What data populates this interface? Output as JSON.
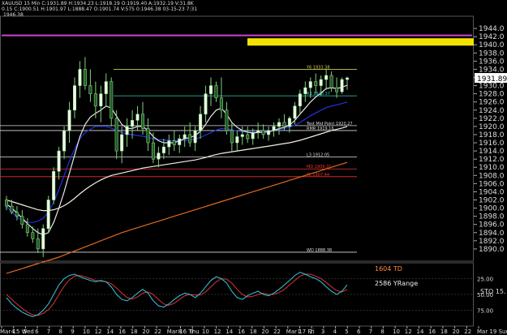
{
  "header": {
    "line1": "XAUUSD  15 Min  C:1931.89  H:1934.23  L:1918.19  O:1919.40  A:1932.19  V:31.8K",
    "line2": "1946.38",
    "line3": "0.15  C:1900.51  H:1901.97  L:1888.47  O:1901.74  V:575  0:1946.38  03-15-23  7:31"
  },
  "chart_data": {
    "type": "candlestick",
    "symbol": "XAUUSD",
    "interval": "15 Min",
    "price_axis": {
      "range": [
        1887,
        1947
      ],
      "ticks": [
        1944.0,
        1942.0,
        1940.0,
        1938.0,
        1936.0,
        1934.0,
        1932.0,
        1930.0,
        1928.0,
        1926.0,
        1924.0,
        1922.0,
        1920.0,
        1918.0,
        1916.0,
        1914.0,
        1912.0,
        1910.0,
        1908.0,
        1906.0,
        1904.0,
        1902.0,
        1900.0,
        1898.0,
        1896.0,
        1894.0,
        1892.0,
        1890.0
      ],
      "last_price": "1931.89"
    },
    "time_axis": {
      "labels": [
        "Mar 15 Wed",
        "4",
        "5",
        "6",
        "7",
        "8",
        "9",
        "10",
        "12",
        "14",
        "16",
        "18",
        "20",
        "22",
        "Mar 16 Thu",
        "8",
        "9",
        "10",
        "12",
        "14",
        "16",
        "18",
        "20",
        "22",
        "Mar 17 Fri",
        "1",
        "2",
        "3",
        "4",
        "5",
        "6",
        "7",
        "8",
        "10",
        "12",
        "14",
        "16",
        "18",
        "20",
        "22",
        "Mar 19 Sun"
      ]
    },
    "candles_ohlc": [
      [
        1902.0,
        1903.0,
        1899.5,
        1900.5
      ],
      [
        1900.5,
        1902.0,
        1898.5,
        1899.0
      ],
      [
        1899.0,
        1900.5,
        1897.0,
        1898.0
      ],
      [
        1898.0,
        1899.5,
        1895.0,
        1896.0
      ],
      [
        1896.0,
        1897.5,
        1893.0,
        1894.0
      ],
      [
        1894.0,
        1895.5,
        1891.5,
        1892.5
      ],
      [
        1892.5,
        1895.0,
        1889.0,
        1890.0
      ],
      [
        1890.0,
        1896.0,
        1888.0,
        1895.0
      ],
      [
        1895.0,
        1903.0,
        1894.0,
        1902.0
      ],
      [
        1902.0,
        1910.0,
        1901.0,
        1909.0
      ],
      [
        1909.0,
        1915.0,
        1907.0,
        1914.0
      ],
      [
        1914.0,
        1920.0,
        1912.0,
        1919.0
      ],
      [
        1919.0,
        1926.0,
        1916.0,
        1924.0
      ],
      [
        1924.0,
        1932.0,
        1922.0,
        1930.0
      ],
      [
        1930.0,
        1936.0,
        1927.0,
        1934.0
      ],
      [
        1934.0,
        1937.0,
        1929.0,
        1930.0
      ],
      [
        1930.0,
        1934.0,
        1926.0,
        1928.0
      ],
      [
        1928.0,
        1931.0,
        1922.0,
        1925.0
      ],
      [
        1925.0,
        1930.0,
        1921.0,
        1928.0
      ],
      [
        1928.0,
        1933.0,
        1925.0,
        1931.0
      ],
      [
        1931.0,
        1932.0,
        1920.0,
        1922.0
      ],
      [
        1922.0,
        1924.0,
        1912.0,
        1914.0
      ],
      [
        1914.0,
        1920.0,
        1911.0,
        1918.0
      ],
      [
        1918.0,
        1922.0,
        1915.0,
        1920.0
      ],
      [
        1920.0,
        1924.0,
        1917.0,
        1921.5
      ],
      [
        1921.5,
        1925.0,
        1919.0,
        1923.0
      ],
      [
        1923.0,
        1926.0,
        1918.0,
        1919.5
      ],
      [
        1919.5,
        1922.0,
        1914.0,
        1916.0
      ],
      [
        1916.0,
        1918.5,
        1911.0,
        1912.0
      ],
      [
        1912.0,
        1915.0,
        1910.0,
        1913.5
      ],
      [
        1913.5,
        1917.0,
        1912.0,
        1915.0
      ],
      [
        1915.0,
        1918.0,
        1913.0,
        1916.5
      ],
      [
        1916.5,
        1919.0,
        1914.0,
        1915.5
      ],
      [
        1915.5,
        1918.0,
        1913.5,
        1917.0
      ],
      [
        1917.0,
        1920.0,
        1915.0,
        1918.0
      ],
      [
        1918.0,
        1921.0,
        1915.0,
        1916.0
      ],
      [
        1916.0,
        1920.0,
        1914.0,
        1919.0
      ],
      [
        1919.0,
        1925.0,
        1917.0,
        1923.0
      ],
      [
        1923.0,
        1930.0,
        1921.0,
        1928.0
      ],
      [
        1928.0,
        1932.0,
        1925.0,
        1930.0
      ],
      [
        1930.0,
        1931.0,
        1926.0,
        1927.0
      ],
      [
        1927.0,
        1932.0,
        1922.0,
        1924.0
      ],
      [
        1924.0,
        1926.0,
        1918.0,
        1919.0
      ],
      [
        1919.0,
        1921.0,
        1914.0,
        1916.0
      ],
      [
        1916.0,
        1919.0,
        1914.0,
        1917.5
      ],
      [
        1917.5,
        1920.0,
        1915.5,
        1918.0
      ],
      [
        1918.0,
        1920.0,
        1916.0,
        1917.0
      ],
      [
        1917.0,
        1919.5,
        1915.5,
        1918.5
      ],
      [
        1918.5,
        1921.0,
        1917.0,
        1919.0
      ],
      [
        1919.0,
        1920.5,
        1917.0,
        1918.0
      ],
      [
        1918.0,
        1920.0,
        1916.5,
        1919.0
      ],
      [
        1919.0,
        1921.0,
        1917.5,
        1920.0
      ],
      [
        1920.0,
        1922.0,
        1918.0,
        1921.0
      ],
      [
        1921.0,
        1923.0,
        1919.0,
        1920.0
      ],
      [
        1920.0,
        1922.5,
        1918.5,
        1922.0
      ],
      [
        1922.0,
        1926.0,
        1920.5,
        1925.0
      ],
      [
        1925.0,
        1929.0,
        1923.0,
        1928.0
      ],
      [
        1928.0,
        1931.0,
        1926.0,
        1929.5
      ],
      [
        1929.5,
        1932.0,
        1927.0,
        1931.0
      ],
      [
        1931.0,
        1933.0,
        1928.0,
        1930.0
      ],
      [
        1930.0,
        1932.5,
        1927.5,
        1931.5
      ],
      [
        1931.5,
        1934.0,
        1929.0,
        1932.5
      ],
      [
        1932.5,
        1933.5,
        1928.5,
        1929.5
      ],
      [
        1929.5,
        1932.0,
        1927.0,
        1928.5
      ],
      [
        1928.5,
        1932.0,
        1928.0,
        1931.5
      ],
      [
        1931.5,
        1932.2,
        1929.0,
        1931.9
      ]
    ],
    "moving_averages": [
      {
        "color": "#2233dd",
        "values": [
          1900.5,
          1899.0,
          1897.8,
          1897.0,
          1896.5,
          1896.5,
          1896.8,
          1897.5,
          1899.0,
          1901.5,
          1904.5,
          1908.0,
          1911.5,
          1914.5,
          1917.0,
          1918.5,
          1919.3,
          1920.0,
          1920.0,
          1920.0,
          1919.6,
          1919.0,
          1918.5,
          1918.2,
          1918.0,
          1917.8,
          1917.6,
          1917.3,
          1917.0,
          1916.8,
          1916.7,
          1916.6,
          1916.5,
          1916.5,
          1916.6,
          1916.7,
          1916.9,
          1917.3,
          1917.9,
          1918.5,
          1919.1,
          1919.5,
          1919.5,
          1919.2,
          1918.9,
          1918.7,
          1918.6,
          1918.6,
          1918.7,
          1918.8,
          1918.9,
          1919.1,
          1919.3,
          1919.5,
          1919.8,
          1920.3,
          1921.0,
          1921.8,
          1922.6,
          1923.3,
          1924.0,
          1924.6,
          1925.0,
          1925.3,
          1925.6,
          1926.0
        ]
      },
      {
        "color": "#e6e6e6",
        "values": [
          1901.0,
          1900.0,
          1898.8,
          1897.5,
          1896.2,
          1895.0,
          1894.0,
          1893.5,
          1894.0,
          1896.5,
          1900.0,
          1904.0,
          1908.5,
          1913.0,
          1917.5,
          1920.5,
          1922.3,
          1923.2,
          1924.0,
          1925.0,
          1924.5,
          1922.5,
          1920.5,
          1919.5,
          1919.5,
          1920.0,
          1920.0,
          1919.0,
          1917.5,
          1916.5,
          1916.0,
          1916.0,
          1916.0,
          1916.5,
          1917.0,
          1917.3,
          1917.8,
          1918.8,
          1920.5,
          1922.5,
          1924.0,
          1924.5,
          1923.0,
          1921.0,
          1919.8,
          1919.0,
          1918.6,
          1918.4,
          1918.5,
          1918.6,
          1918.7,
          1919.0,
          1919.5,
          1919.8,
          1920.3,
          1921.5,
          1923.0,
          1924.5,
          1926.0,
          1927.2,
          1928.2,
          1929.3,
          1929.5,
          1929.3,
          1929.6,
          1930.1
        ]
      },
      {
        "color": "#f0f0e0",
        "values": [
          1902.0,
          1901.6,
          1901.2,
          1900.8,
          1900.4,
          1900.0,
          1899.6,
          1899.4,
          1899.4,
          1899.6,
          1900.0,
          1900.6,
          1901.4,
          1902.4,
          1903.5,
          1904.5,
          1905.4,
          1906.2,
          1906.9,
          1907.5,
          1908.0,
          1908.3,
          1908.6,
          1908.9,
          1909.2,
          1909.5,
          1909.8,
          1910.0,
          1910.2,
          1910.4,
          1910.6,
          1910.8,
          1911.0,
          1911.2,
          1911.4,
          1911.6,
          1911.8,
          1912.1,
          1912.4,
          1912.8,
          1913.1,
          1913.4,
          1913.6,
          1913.8,
          1914.0,
          1914.2,
          1914.4,
          1914.6,
          1914.8,
          1915.0,
          1915.2,
          1915.4,
          1915.6,
          1915.8,
          1916.0,
          1916.3,
          1916.6,
          1917.0,
          1917.4,
          1917.8,
          1918.2,
          1918.6,
          1919.0,
          1919.3,
          1919.6,
          1920.0
        ]
      },
      {
        "color": "#e06a1e",
        "values": [
          1884.0,
          1884.4,
          1884.8,
          1885.2,
          1885.6,
          1886.0,
          1886.4,
          1886.8,
          1887.2,
          1887.6,
          1888.0,
          1888.5,
          1889.0,
          1889.5,
          1890.0,
          1890.5,
          1891.0,
          1891.5,
          1892.0,
          1892.5,
          1893.0,
          1893.5,
          1894.0,
          1894.4,
          1894.8,
          1895.2,
          1895.6,
          1896.0,
          1896.4,
          1896.8,
          1897.2,
          1897.6,
          1898.0,
          1898.4,
          1898.8,
          1899.2,
          1899.6,
          1900.0,
          1900.4,
          1900.8,
          1901.2,
          1901.6,
          1902.0,
          1902.4,
          1902.8,
          1903.2,
          1903.6,
          1904.0,
          1904.4,
          1904.8,
          1905.2,
          1905.6,
          1906.0,
          1906.4,
          1906.8,
          1907.2,
          1907.6,
          1908.0,
          1908.4,
          1908.8,
          1909.2,
          1909.6,
          1910.0,
          1910.4,
          1910.8,
          1911.2
        ]
      }
    ],
    "levels": [
      {
        "price": 1942.3,
        "label": "",
        "color": "#cc44cc"
      },
      {
        "price": 1934.0,
        "label": "Y6 1933.38",
        "color": "#cccc55"
      },
      {
        "price": 1927.5,
        "label": "R3 1928.37",
        "color": "#33ccbb"
      },
      {
        "price": 1920.2,
        "label": "Test Mid Point 1920.27",
        "color": "#dddddd"
      },
      {
        "price": 1919.0,
        "label": "RMR 1919.16",
        "color": "#dddddd"
      },
      {
        "price": 1912.5,
        "label": "L3 1912.05",
        "color": "#dddddd"
      },
      {
        "price": 1909.6,
        "label": "MD 1909.31",
        "color": "#ee3333"
      },
      {
        "price": 1907.7,
        "label": "YL 1907.44",
        "color": "#ee3333"
      },
      {
        "price": 1889.2,
        "label": "WD 1888.38",
        "color": "#dddddd"
      }
    ],
    "stochastic": {
      "name": "STO",
      "period": "15",
      "level_labels": [
        "25.00",
        "50.00",
        "75.00"
      ],
      "k": [
        45,
        35,
        28,
        22,
        18,
        15,
        18,
        25,
        35,
        50,
        65,
        75,
        80,
        82,
        78,
        75,
        72,
        70,
        72,
        70,
        62,
        50,
        42,
        40,
        45,
        52,
        58,
        52,
        40,
        32,
        30,
        35,
        42,
        48,
        52,
        50,
        45,
        52,
        62,
        72,
        78,
        75,
        68,
        55,
        45,
        42,
        48,
        52,
        55,
        50,
        48,
        52,
        58,
        65,
        72,
        80,
        85,
        82,
        78,
        75,
        70,
        62,
        55,
        50,
        55,
        65
      ],
      "d": [
        50,
        42,
        35,
        28,
        22,
        18,
        17,
        20,
        26,
        36,
        50,
        63,
        73,
        79,
        80,
        78,
        75,
        72,
        71,
        70,
        67,
        60,
        52,
        45,
        43,
        46,
        52,
        54,
        50,
        42,
        35,
        33,
        36,
        42,
        48,
        50,
        49,
        49,
        54,
        62,
        70,
        75,
        74,
        68,
        58,
        50,
        46,
        47,
        50,
        52,
        50,
        50,
        53,
        58,
        65,
        72,
        79,
        82,
        82,
        79,
        75,
        69,
        62,
        56,
        54,
        58
      ]
    },
    "annotations": {
      "td": "1604 TD",
      "yrange": "2586 YRange",
      "sto_label": "STO",
      "sto_value": "15."
    }
  }
}
